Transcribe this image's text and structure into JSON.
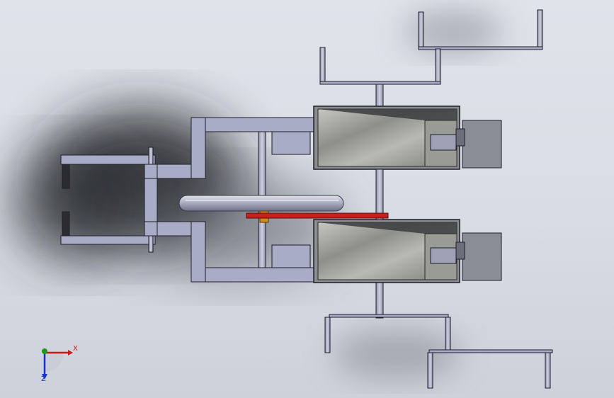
{
  "viewport": {
    "name": "solidworks-graphics-area",
    "background": "#dde1e8",
    "part_color": "#a8abc6",
    "part_edge": "#1e1e28",
    "housing_color": "#8d8f96",
    "belt_color": "#c8201a"
  },
  "triad": {
    "x_label": "X",
    "y_label": "Y",
    "z_label": "Z",
    "x_color": "#d01818",
    "y_color": "#1a9a1a",
    "z_color": "#1a2fd0"
  }
}
